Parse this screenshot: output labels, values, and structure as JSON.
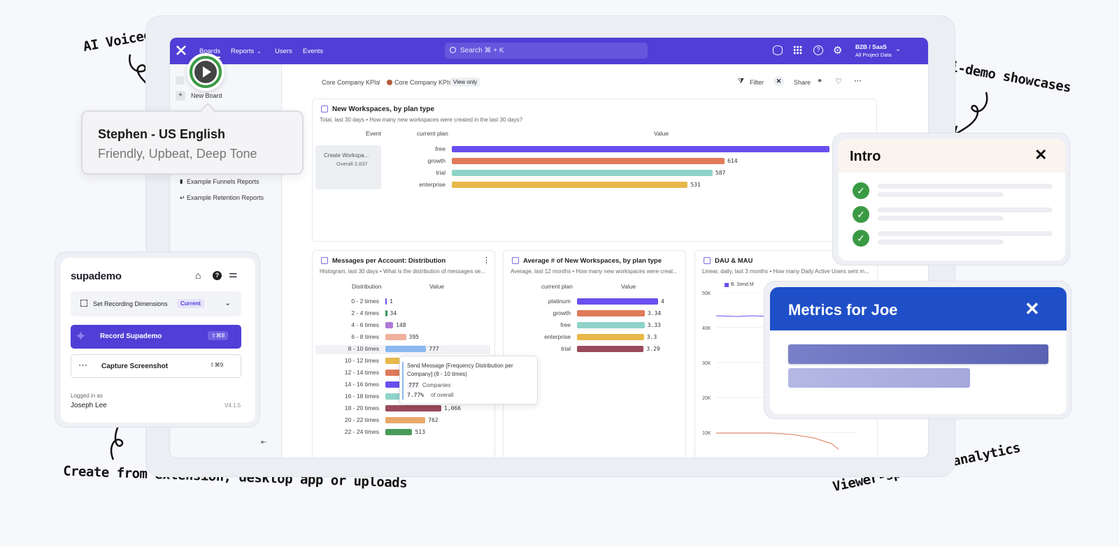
{
  "annotations": {
    "voiceovers": "AI Voiceovers",
    "multi_demo": "Multi-demo showcases",
    "create_from": "Create from extension, desktop app or uploads",
    "viewer_specific": "Viewer-specific analytics"
  },
  "topbar": {
    "nav": [
      "Boards",
      "Reports",
      "Users",
      "Events"
    ],
    "search_placeholder": "Search ⌘ + K",
    "project_name": "B2B / SaaS",
    "project_scope": "All Project Data"
  },
  "sidebar": {
    "new_board": "New Board",
    "links": [
      "Example Funnels Reports",
      "Example Retention Reports"
    ]
  },
  "breadcrumb": {
    "root": "Core Company KPIs",
    "current": "Core Company KPIs",
    "badge": "View only",
    "filter": "Filter",
    "share": "Share"
  },
  "voice_popup": {
    "name": "Stephen - US English",
    "style": "Friendly, Upbeat, Deep Tone"
  },
  "card_main": {
    "title": "New Workspaces, by plan type",
    "subtitle": "Total, last 30 days • How many new workspaces were created in the last 30 days?",
    "col_event": "Event",
    "col_plan": "current plan",
    "col_value": "Value",
    "event_name": "Create Workspa...",
    "event_overall": "Overall  2,637"
  },
  "card_dist": {
    "title": "Messages per Account: Distribution",
    "subtitle": "Histogram, last 30 days • What is the distribution of messages se...",
    "col_dist": "Distribution",
    "col_value": "Value"
  },
  "card_avg": {
    "title": "Average # of New Workspaces, by plan type",
    "subtitle": "Average, last 12 months • How many new workspaces were creat...",
    "col_plan": "current plan",
    "col_value": "Value"
  },
  "card_dau": {
    "title": "DAU & MAU",
    "subtitle": "Linear, daily, last 3 months • How many Daily Active Users sent m...",
    "legend": "B. Send M",
    "yticks": [
      "50K",
      "40K",
      "30K",
      "20K",
      "10K"
    ]
  },
  "tooltip": {
    "title": "Send Message [Frequency Distribution per Company] (8 - 10 times)",
    "count": "777",
    "count_label": "Companies",
    "pct": "7.77%",
    "pct_label": "of overall"
  },
  "supademo": {
    "brand": "supademo",
    "dimensions_label": "Set Recording Dimensions",
    "dimensions_badge": "Current",
    "record_label": "Record Supademo",
    "record_shortcut": "⇧⌘8",
    "capture_label": "Capture Screenshot",
    "capture_shortcut": "⇧⌘9",
    "logged_in_label": "Logged in as",
    "user_name": "Joseph Lee",
    "version": "V4.1.5"
  },
  "intro_panel": {
    "title": "Intro"
  },
  "metrics_panel": {
    "title": "Metrics for Joe"
  },
  "colors": {
    "brand": "#4f3fd6",
    "metrics_header": "#1f4fc8",
    "check": "#3a9a44"
  },
  "chart_data": [
    {
      "type": "bar",
      "title": "New Workspaces, by plan type",
      "categories": [
        "free",
        "growth",
        "trial",
        "enterprise"
      ],
      "values": [
        850,
        614,
        587,
        531
      ],
      "colors": [
        "#6a4ff0",
        "#e07a5a",
        "#8fd3c8",
        "#e8b84a"
      ],
      "labels": [
        "",
        "614",
        "587",
        "531"
      ]
    },
    {
      "type": "bar",
      "title": "Messages per Account: Distribution",
      "categories": [
        "0 - 2 times",
        "2 - 4 times",
        "4 - 6 times",
        "6 - 8 times",
        "8 - 10 times",
        "10 - 12 times",
        "12 - 14 times",
        "14 - 16 times",
        "16 - 18 times",
        "18 - 20 times",
        "20 - 22 times",
        "22 - 24 times"
      ],
      "values": [
        1,
        34,
        148,
        395,
        777,
        500,
        500,
        500,
        500,
        1066,
        762,
        513
      ],
      "colors": [
        "#6a4ff0",
        "#3a9a5a",
        "#b07ad8",
        "#f0b0a0",
        "#8ab8f0",
        "#e8b84a",
        "#e07a5a",
        "#6a4ff0",
        "#8fd3c8",
        "#9a4a5a",
        "#e8a86a",
        "#4a9a5a"
      ],
      "labels": [
        "1",
        "34",
        "148",
        "395",
        "777",
        "",
        "",
        "",
        "",
        "1,066",
        "762",
        "513"
      ]
    },
    {
      "type": "bar",
      "title": "Average # of New Workspaces, by plan type",
      "categories": [
        "platinum",
        "growth",
        "free",
        "enterprise",
        "trial"
      ],
      "values": [
        4,
        3.34,
        3.33,
        3.3,
        3.29
      ],
      "colors": [
        "#6a4ff0",
        "#e07a5a",
        "#8fd3c8",
        "#e8b84a",
        "#9a4a5a"
      ],
      "labels": [
        "4",
        "3.34",
        "3.33",
        "3.3",
        "3.29"
      ]
    }
  ]
}
